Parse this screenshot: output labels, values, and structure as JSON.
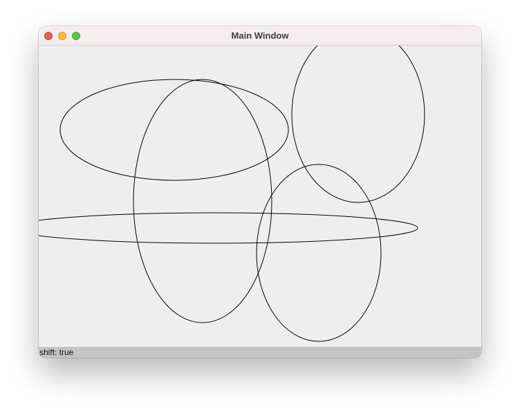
{
  "window": {
    "title": "Main Window"
  },
  "status": {
    "text": "shift: true"
  },
  "colors": {
    "titlebar_bg": "#f4eeee",
    "canvas_bg": "#eeeeee",
    "statusbar_bg": "#c4c4c4",
    "stroke": "#000000",
    "close": "#ec5f57",
    "minimize": "#f4bd2f",
    "zoom": "#5fc43f"
  }
}
